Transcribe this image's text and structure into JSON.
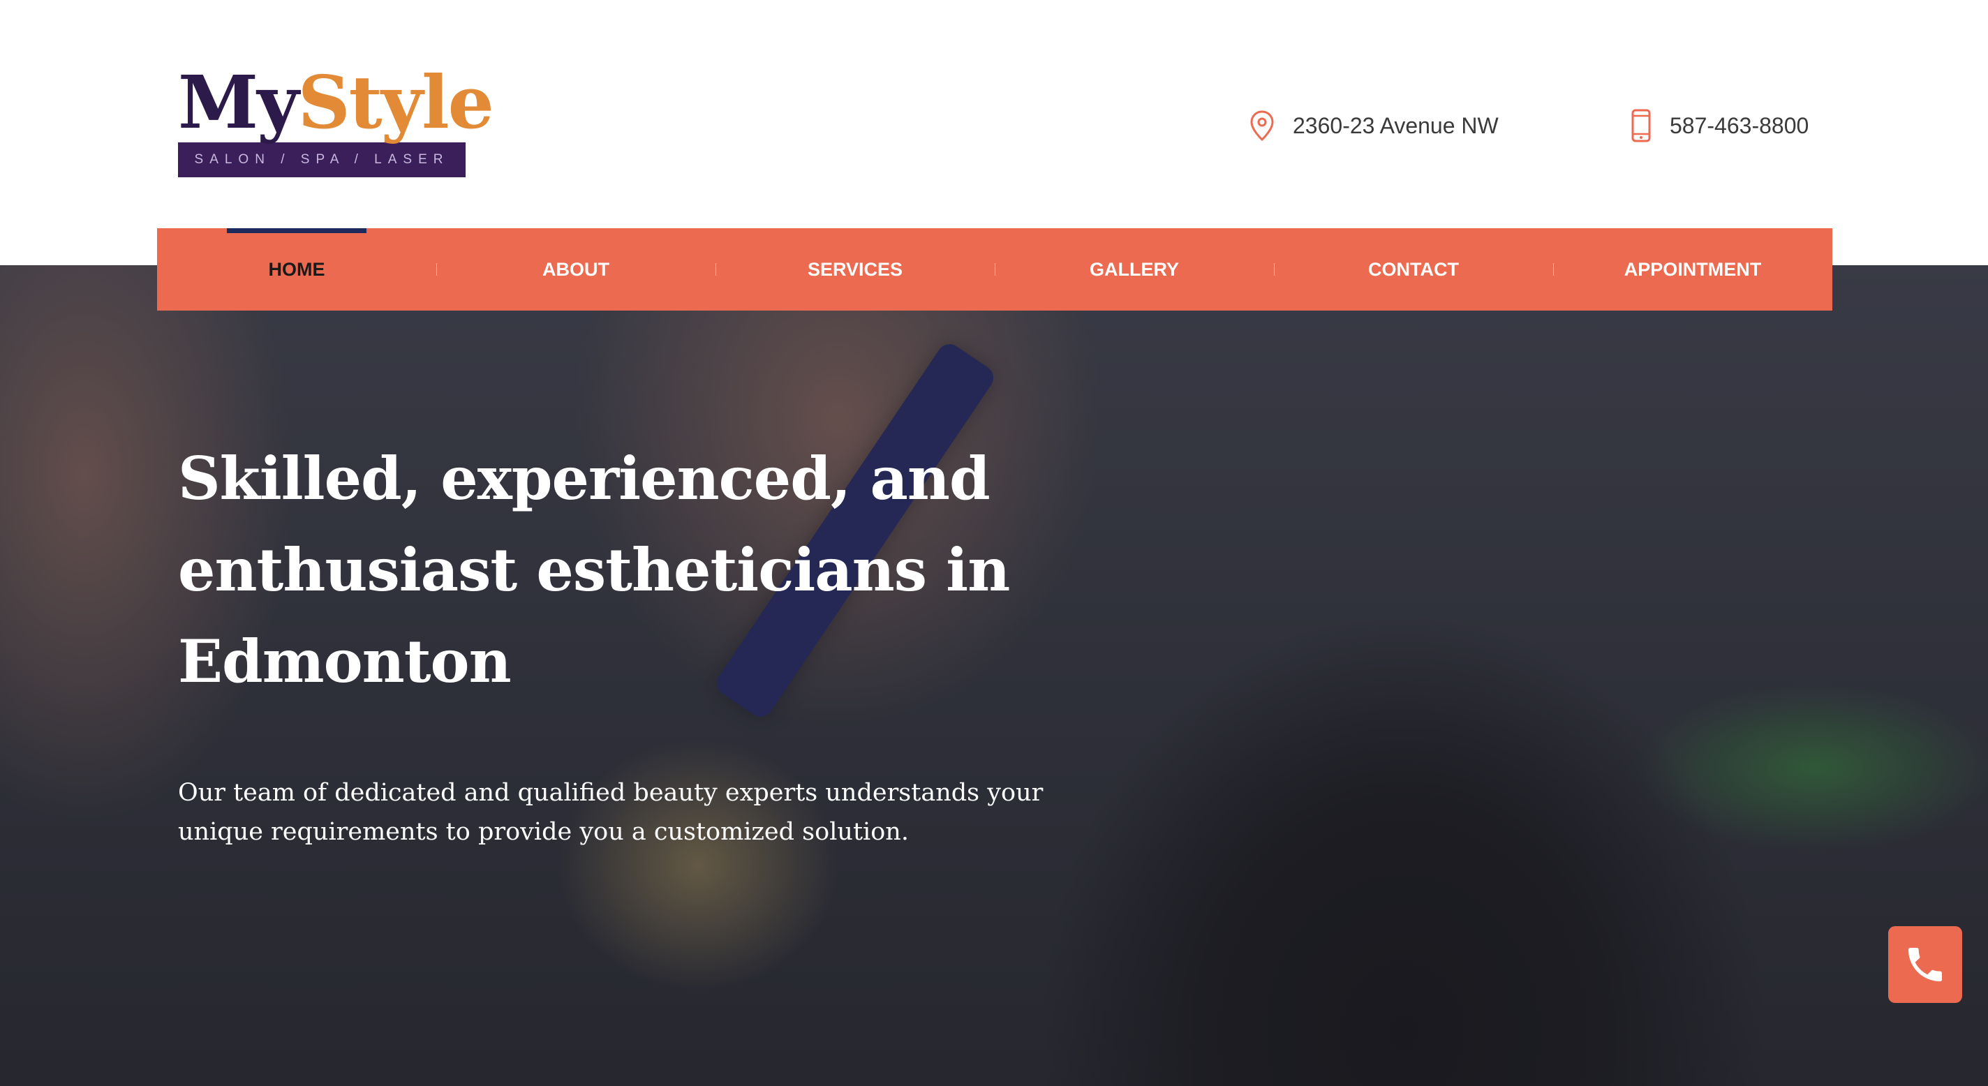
{
  "brand": {
    "name_part1": "My",
    "name_part2": "Style",
    "tagline": "SALON / SPA / LASER",
    "colors": {
      "dark_purple": "#2b1a4a",
      "orange": "#e38a37",
      "accent": "#ec6a50",
      "active_bar": "#1f2a5c"
    }
  },
  "header": {
    "address": {
      "icon": "location-pin-icon",
      "text": "2360-23 Avenue NW"
    },
    "phone": {
      "icon": "mobile-phone-icon",
      "text": "587-463-8800"
    }
  },
  "nav": {
    "items": [
      {
        "label": "HOME",
        "active": true
      },
      {
        "label": "ABOUT",
        "active": false
      },
      {
        "label": "SERVICES",
        "active": false
      },
      {
        "label": "GALLERY",
        "active": false
      },
      {
        "label": "CONTACT",
        "active": false
      },
      {
        "label": "APPOINTMENT",
        "active": false
      }
    ]
  },
  "hero": {
    "title": "Skilled, experienced, and enthusiast estheticians in Edmonton",
    "subtitle": "Our team of dedicated and qualified beauty experts understands your unique requirements to provide you a customized solution."
  },
  "floating": {
    "call_icon": "phone-icon"
  }
}
